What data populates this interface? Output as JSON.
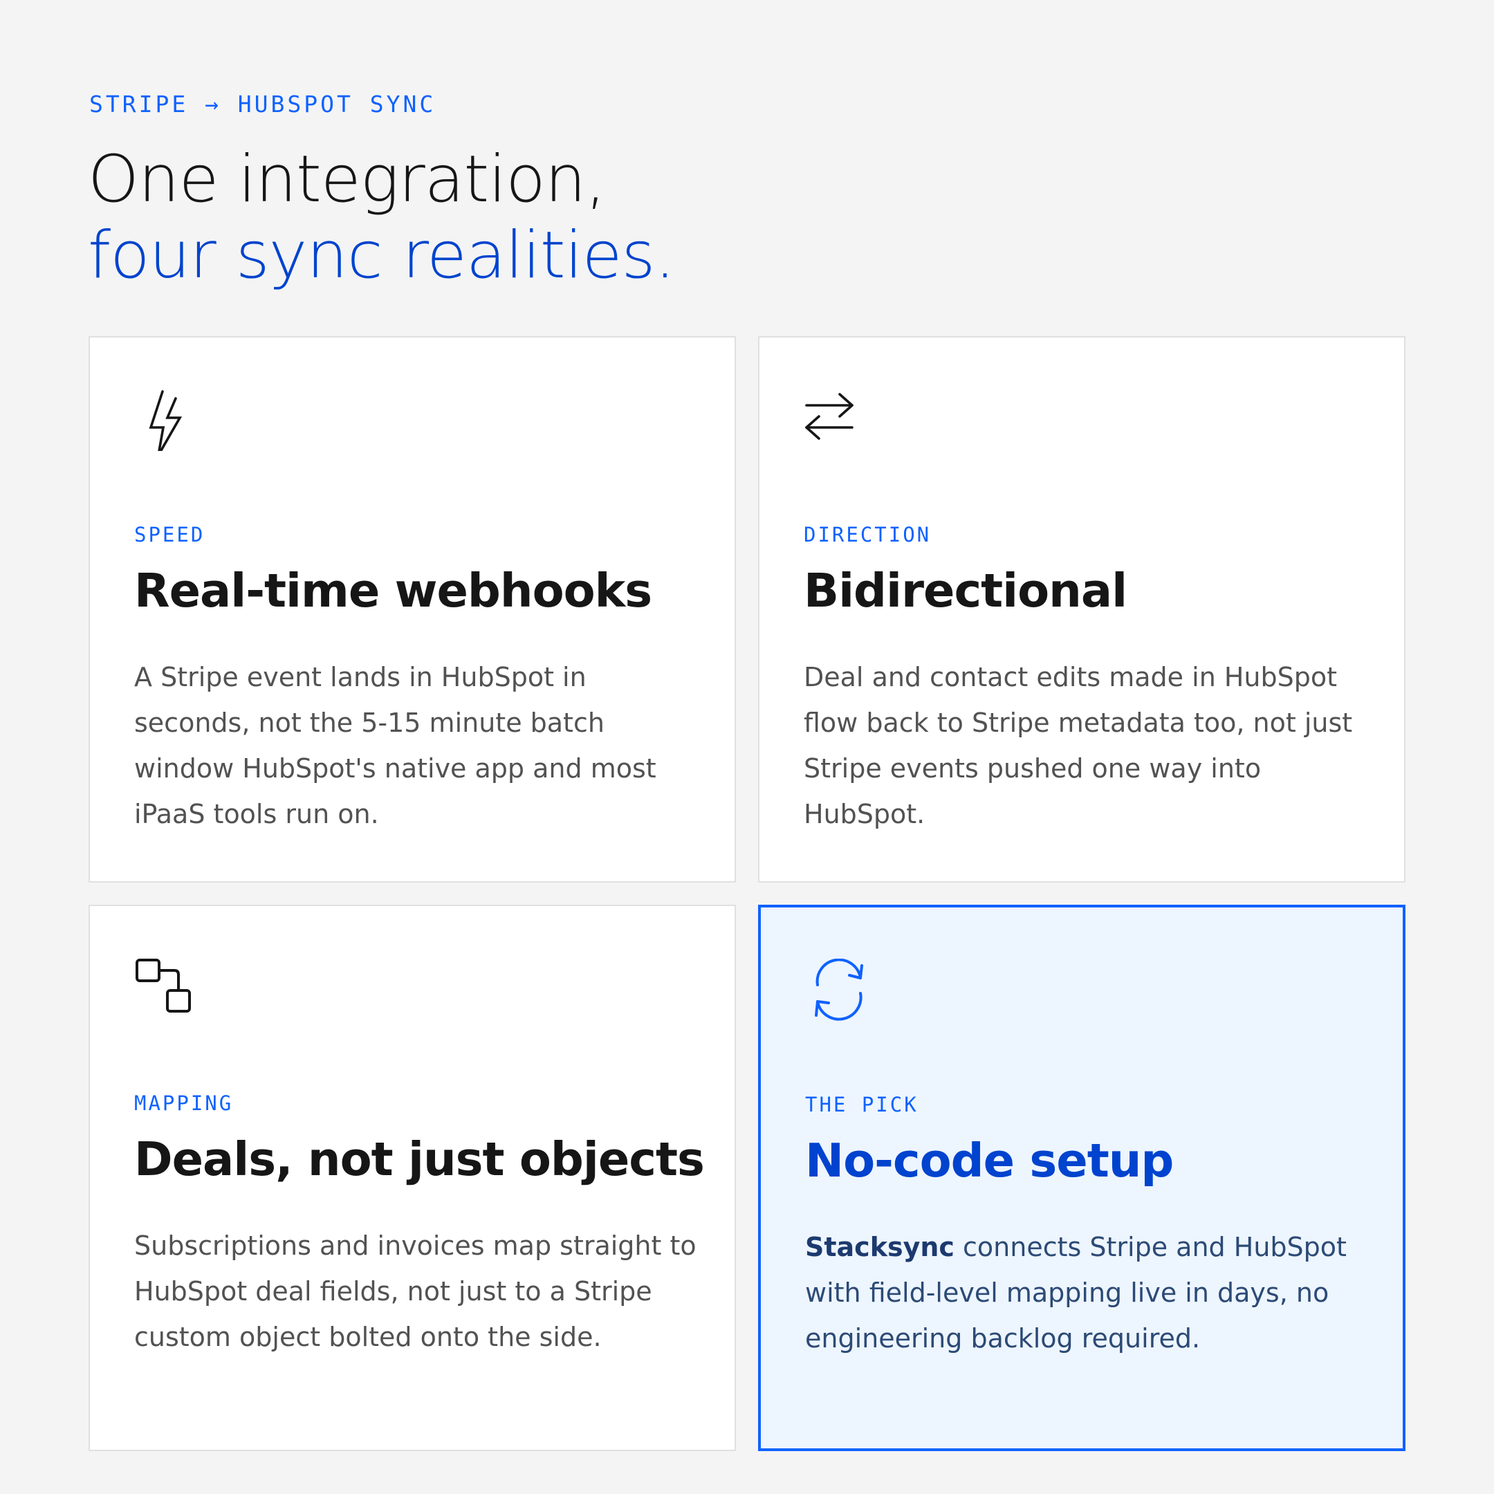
{
  "eyebrow": "STRIPE → HUBSPOT SYNC",
  "headline": {
    "line1": "One integration,",
    "line2": "four sync realities."
  },
  "colors": {
    "accent": "#0f62fe",
    "accent_dark": "#0043ce",
    "pick_background": "#edf5ff",
    "page_background": "#f4f4f4"
  },
  "cards": [
    {
      "icon": "lightning-bolt-icon",
      "label": "SPEED",
      "title": "Real-time webhooks",
      "body": "A Stripe event lands in HubSpot in seconds, not the 5-15 minute batch window HubSpot's native app and most iPaaS tools run on."
    },
    {
      "icon": "swap-arrows-icon",
      "label": "DIRECTION",
      "title": "Bidirectional",
      "body": "Deal and contact edits made in HubSpot flow back to Stripe metadata too, not just Stripe events pushed one way into HubSpot."
    },
    {
      "icon": "connected-squares-icon",
      "label": "MAPPING",
      "title": "Deals, not just objects",
      "body": "Subscriptions and invoices map straight to HubSpot deal fields, not just to a Stripe custom object bolted onto the side."
    },
    {
      "icon": "sync-arrows-icon",
      "label": "THE PICK",
      "title": "No-code setup",
      "body_brand": "Stacksync",
      "body": " connects Stripe and HubSpot with field-level mapping live in days, no engineering backlog required."
    }
  ]
}
